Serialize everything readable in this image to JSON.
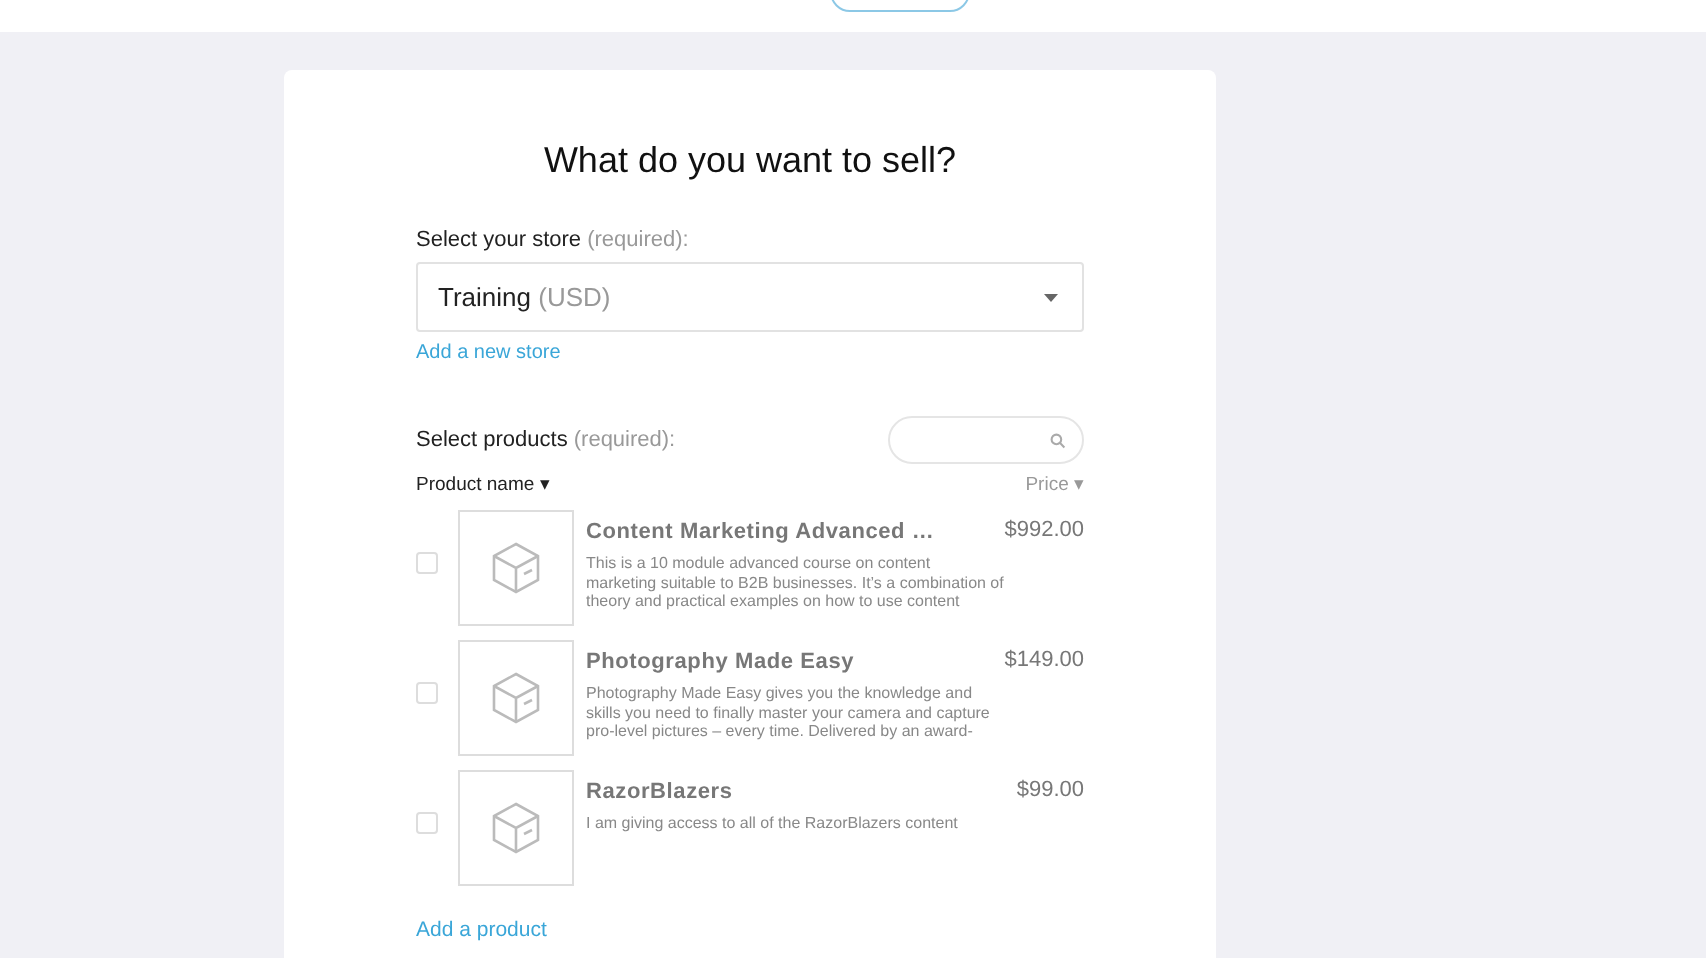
{
  "title": "What do you want to sell?",
  "store": {
    "label": "Select your store",
    "hint": "(required):",
    "value": "Training",
    "currency": "(USD)",
    "add_link": "Add a new store"
  },
  "products": {
    "label": "Select products",
    "hint": "(required):",
    "columns": [
      {
        "label": "Product name",
        "caret": "▾"
      },
      {
        "label": "Price",
        "caret": "▾"
      }
    ],
    "rows": [
      {
        "name": "Content Marketing Advanced …",
        "description": "This is a 10 module advanced course on content marketing suitable to B2B businesses. It’s a combination of theory and practical examples on how to use content",
        "price": "$992.00",
        "checked": false
      },
      {
        "name": "Photography Made Easy",
        "description": "Photography Made Easy gives you the knowledge and skills you need to finally master your camera and capture pro-level pictures – every time. Delivered by an award-",
        "price": "$149.00",
        "checked": false
      },
      {
        "name": "RazorBlazers",
        "description": "I am giving access to all of the RazorBlazers content",
        "price": "$99.00",
        "checked": false
      }
    ],
    "add_link": "Add a product"
  }
}
